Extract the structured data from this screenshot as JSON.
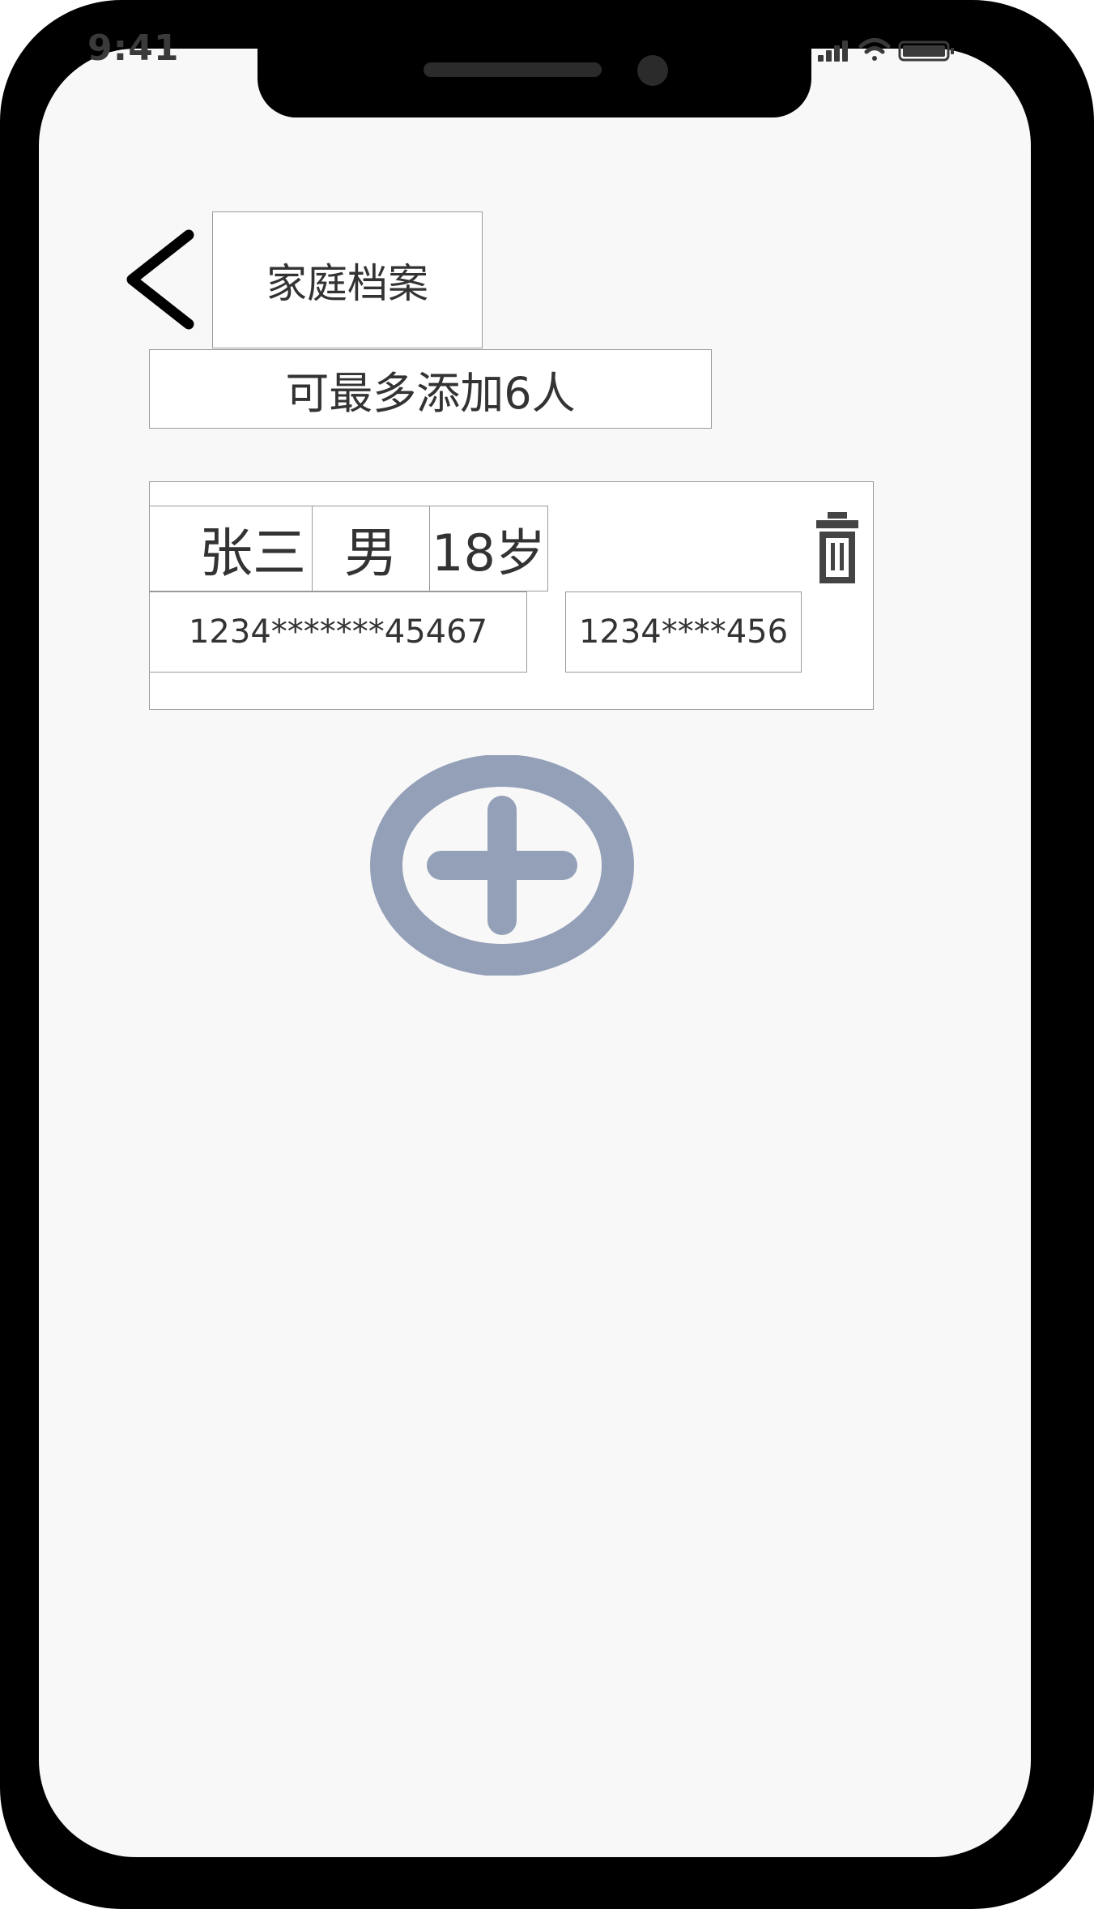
{
  "status_bar": {
    "time": "9:41"
  },
  "header": {
    "title": "家庭档案"
  },
  "notice": {
    "text": "可最多添加6人"
  },
  "member": {
    "name": "张三",
    "gender": "男",
    "age": "18岁",
    "id_number": "1234*******45467",
    "phone": "1234****456"
  },
  "icons": {
    "back": "chevron-left-icon",
    "delete": "trash-icon",
    "add": "plus-circle-icon"
  },
  "colors": {
    "add_icon": "#94a0b8",
    "text": "#333333",
    "border": "#9a9a9a"
  }
}
